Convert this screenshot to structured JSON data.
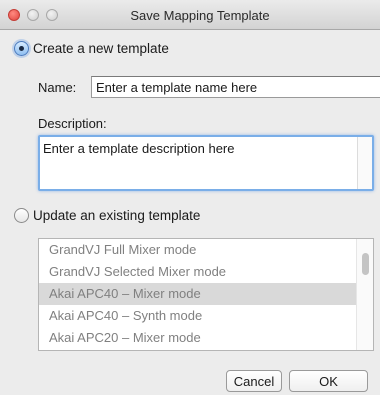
{
  "window": {
    "title": "Save Mapping Template"
  },
  "create": {
    "label": "Create a new template",
    "name_label": "Name:",
    "name_value": "Enter a template name here",
    "description_label": "Description:",
    "description_value": "Enter a template description here"
  },
  "update": {
    "label": "Update an existing template",
    "templates": [
      "GrandVJ Full Mixer mode",
      "GrandVJ Selected Mixer mode",
      "Akai APC40 – Mixer mode",
      "Akai APC40 – Synth mode",
      "Akai APC20 – Mixer mode"
    ],
    "selected_index": 2
  },
  "buttons": {
    "cancel": "Cancel",
    "ok": "OK"
  },
  "colors": {
    "focus_ring": "#7aaee8",
    "close_button": "#e0443e",
    "list_text": "#808080"
  }
}
